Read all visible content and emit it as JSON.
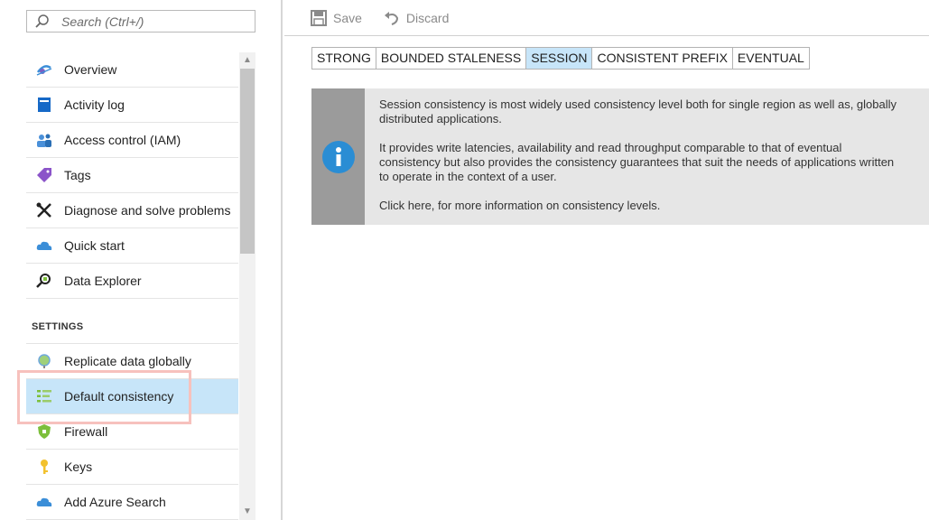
{
  "search": {
    "placeholder": "Search (Ctrl+/)"
  },
  "nav": {
    "items": [
      {
        "label": "Overview",
        "icon": "overview-icon"
      },
      {
        "label": "Activity log",
        "icon": "activity-log-icon"
      },
      {
        "label": "Access control (IAM)",
        "icon": "people-icon"
      },
      {
        "label": "Tags",
        "icon": "tag-icon"
      },
      {
        "label": "Diagnose and solve problems",
        "icon": "wrench-icon"
      },
      {
        "label": "Quick start",
        "icon": "cloud-icon"
      },
      {
        "label": "Data Explorer",
        "icon": "data-explorer-icon"
      }
    ],
    "settings_header": "SETTINGS",
    "settings_items": [
      {
        "label": "Replicate data globally",
        "icon": "globe-icon"
      },
      {
        "label": "Default consistency",
        "icon": "consistency-icon",
        "active": true
      },
      {
        "label": "Firewall",
        "icon": "firewall-shield-icon"
      },
      {
        "label": "Keys",
        "icon": "key-icon"
      },
      {
        "label": "Add Azure Search",
        "icon": "azure-search-cloud-icon"
      }
    ]
  },
  "toolbar": {
    "save_label": "Save",
    "discard_label": "Discard"
  },
  "consistency": {
    "levels": [
      "STRONG",
      "BOUNDED STALENESS",
      "SESSION",
      "CONSISTENT PREFIX",
      "EVENTUAL"
    ],
    "selected": "SESSION"
  },
  "info": {
    "lines": [
      "Session consistency is most widely used consistency level both for single region as well as, globally",
      "distributed applications.",
      "It provides write latencies, availability and read throughput comparable to that of eventual",
      "consistency but also provides the consistency guarantees that suit the needs of applications written",
      "to operate in the context of a user.",
      "Click here, for more information on consistency levels."
    ]
  },
  "colors": {
    "active_bg": "#c7e5f9",
    "highlight_border": "#f7c1bd",
    "info_bg": "#e6e6e6",
    "info_side": "#9b9b9b",
    "info_icon": "#2a8dd4"
  }
}
